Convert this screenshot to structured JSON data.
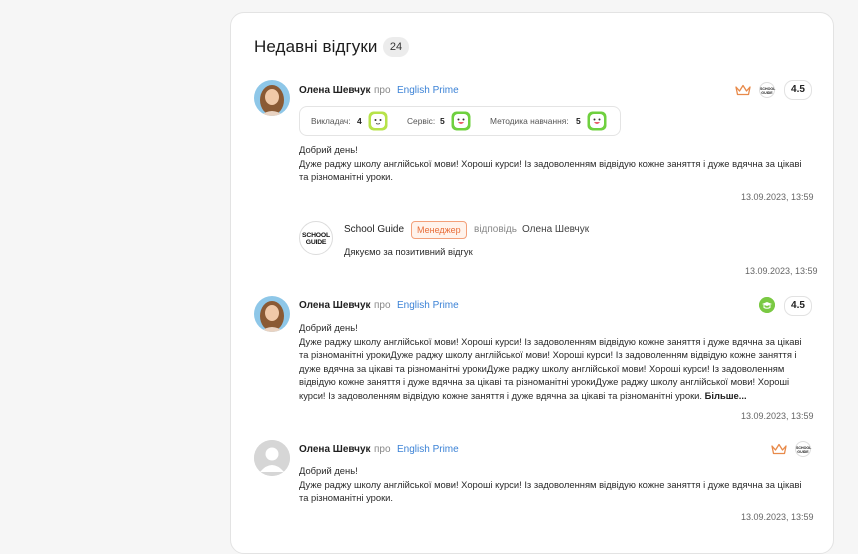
{
  "header": {
    "title": "Недавні відгуки",
    "count": "24"
  },
  "reviews": [
    {
      "name": "Олена Шевчук",
      "pro": "про",
      "school": "English Prime",
      "rating": "4.5",
      "scores": [
        {
          "label": "Викладач:",
          "value": "4"
        },
        {
          "label": "Сервіс:",
          "value": "5"
        },
        {
          "label": "Методика навчання:",
          "value": "5"
        }
      ],
      "text": [
        "Добрий день!",
        "Дуже раджу школу англійської мови! Хороші курси! Із задоволенням відвідую кожне заняття і дуже вдячна за цікаві та різноманітні уроки."
      ],
      "date": "13.09.2023, 13:59",
      "reply": {
        "logo": "SCHOOL GUIDE",
        "name": "School Guide",
        "badge": "Менеджер",
        "verb": "відповідь",
        "to": "Олена Шевчук",
        "text": "Дякуємо за позитивний відгук",
        "date": "13.09.2023, 13:59"
      }
    },
    {
      "name": "Олена Шевчук",
      "pro": "про",
      "school": "English Prime",
      "rating": "4.5",
      "text": [
        "Добрий день!",
        "Дуже раджу школу англійської мови! Хороші курси! Із задоволенням відвідую кожне заняття і дуже вдячна за цікаві та різноманітні урокиДуже раджу школу англійської мови! Хороші курси! Із задоволенням відвідую кожне заняття і дуже вдячна за цікаві та різноманітні урокиДуже раджу школу англійської мови! Хороші курси! Із задоволенням відвідую кожне заняття і дуже вдячна за цікаві та різноманітні урокиДуже раджу школу англійської мови! Хороші курси! Із задоволенням відвідую кожне заняття і дуже вдячна за цікаві та різноманітні уроки."
      ],
      "more": "Більше...",
      "date": "13.09.2023, 13:59"
    },
    {
      "name": "Олена Шевчук",
      "pro": "про",
      "school": "English Prime",
      "text": [
        "Добрий день!",
        "Дуже раджу школу англійської мови! Хороші курси! Із задоволенням відвідую кожне заняття і дуже вдячна за цікаві та різноманітні уроки."
      ],
      "date": "13.09.2023, 13:59"
    }
  ],
  "small_logo_text": "SCHOOL GUIDE",
  "colors": {
    "accent": "#3b82d6",
    "badge": "#e86e3a",
    "face_lime": "#b7e34a",
    "face_green": "#6fd03f",
    "crown": "#e88a4a"
  }
}
